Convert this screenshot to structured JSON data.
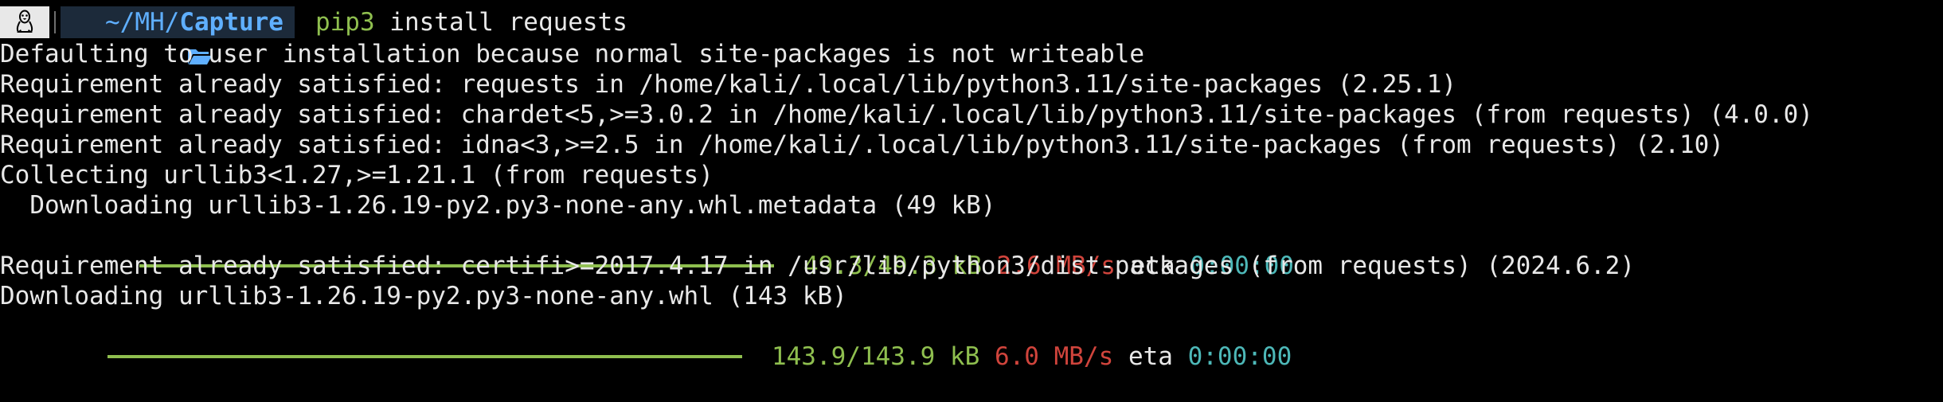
{
  "prompt": {
    "os_icon": "linux-penguin-icon",
    "folder_icon": "folder-open-icon",
    "path_prefix": "~/MH/",
    "path_current": "Capture",
    "command_name": "pip3",
    "command_args": " install requests"
  },
  "output": {
    "line1": "Defaulting to user installation because normal site-packages is not writeable",
    "line2": "Requirement already satisfied: requests in /home/kali/.local/lib/python3.11/site-packages (2.25.1)",
    "line3": "Requirement already satisfied: chardet<5,>=3.0.2 in /home/kali/.local/lib/python3.11/site-packages (from requests) (4.0.0)",
    "line4": "Requirement already satisfied: idna<3,>=2.5 in /home/kali/.local/lib/python3.11/site-packages (from requests) (2.10)",
    "line5": "Collecting urllib3<1.27,>=1.21.1 (from requests)",
    "line6": "  Downloading urllib3-1.26.19-py2.py3-none-any.whl.metadata (49 kB)",
    "progress1": {
      "fraction": 1.0,
      "size": "49.3/49.3 kB",
      "speed": "2.6 MB/s",
      "eta_label": "eta",
      "eta": "0:00:00"
    },
    "line8": "Requirement already satisfied: certifi>=2017.4.17 in /usr/lib/python3/dist-packages (from requests) (2024.6.2)",
    "line9": "Downloading urllib3-1.26.19-py2.py3-none-any.whl (143 kB)",
    "progress2": {
      "fraction": 1.0,
      "size": "143.9/143.9 kB",
      "speed": "6.0 MB/s",
      "eta_label": "eta",
      "eta": "0:00:00"
    }
  },
  "colors": {
    "background": "#000000",
    "foreground": "#e8e8e8",
    "path_blue": "#5fafff",
    "command_green": "#8fbf4f",
    "speed_red": "#d0443c",
    "eta_cyan": "#4db8b8"
  }
}
